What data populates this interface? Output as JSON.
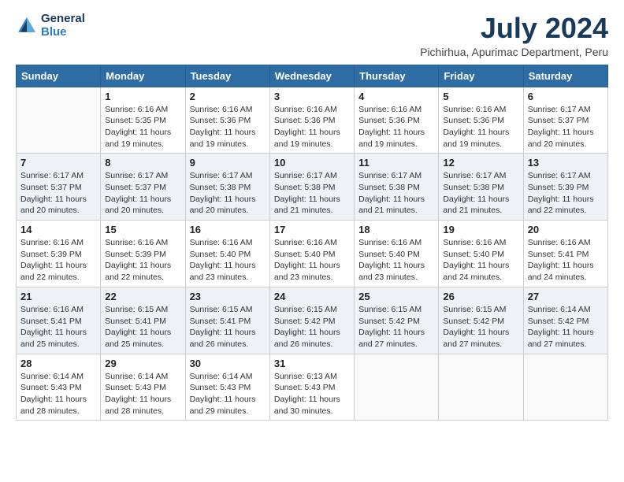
{
  "header": {
    "logo_line1": "General",
    "logo_line2": "Blue",
    "title": "July 2024",
    "subtitle": "Pichirhua, Apurimac Department, Peru"
  },
  "weekdays": [
    "Sunday",
    "Monday",
    "Tuesday",
    "Wednesday",
    "Thursday",
    "Friday",
    "Saturday"
  ],
  "weeks": [
    [
      {
        "day": "",
        "info": ""
      },
      {
        "day": "1",
        "info": "Sunrise: 6:16 AM\nSunset: 5:35 PM\nDaylight: 11 hours\nand 19 minutes."
      },
      {
        "day": "2",
        "info": "Sunrise: 6:16 AM\nSunset: 5:36 PM\nDaylight: 11 hours\nand 19 minutes."
      },
      {
        "day": "3",
        "info": "Sunrise: 6:16 AM\nSunset: 5:36 PM\nDaylight: 11 hours\nand 19 minutes."
      },
      {
        "day": "4",
        "info": "Sunrise: 6:16 AM\nSunset: 5:36 PM\nDaylight: 11 hours\nand 19 minutes."
      },
      {
        "day": "5",
        "info": "Sunrise: 6:16 AM\nSunset: 5:36 PM\nDaylight: 11 hours\nand 19 minutes."
      },
      {
        "day": "6",
        "info": "Sunrise: 6:17 AM\nSunset: 5:37 PM\nDaylight: 11 hours\nand 20 minutes."
      }
    ],
    [
      {
        "day": "7",
        "info": "Sunrise: 6:17 AM\nSunset: 5:37 PM\nDaylight: 11 hours\nand 20 minutes."
      },
      {
        "day": "8",
        "info": "Sunrise: 6:17 AM\nSunset: 5:37 PM\nDaylight: 11 hours\nand 20 minutes."
      },
      {
        "day": "9",
        "info": "Sunrise: 6:17 AM\nSunset: 5:38 PM\nDaylight: 11 hours\nand 20 minutes."
      },
      {
        "day": "10",
        "info": "Sunrise: 6:17 AM\nSunset: 5:38 PM\nDaylight: 11 hours\nand 21 minutes."
      },
      {
        "day": "11",
        "info": "Sunrise: 6:17 AM\nSunset: 5:38 PM\nDaylight: 11 hours\nand 21 minutes."
      },
      {
        "day": "12",
        "info": "Sunrise: 6:17 AM\nSunset: 5:38 PM\nDaylight: 11 hours\nand 21 minutes."
      },
      {
        "day": "13",
        "info": "Sunrise: 6:17 AM\nSunset: 5:39 PM\nDaylight: 11 hours\nand 22 minutes."
      }
    ],
    [
      {
        "day": "14",
        "info": "Sunrise: 6:16 AM\nSunset: 5:39 PM\nDaylight: 11 hours\nand 22 minutes."
      },
      {
        "day": "15",
        "info": "Sunrise: 6:16 AM\nSunset: 5:39 PM\nDaylight: 11 hours\nand 22 minutes."
      },
      {
        "day": "16",
        "info": "Sunrise: 6:16 AM\nSunset: 5:40 PM\nDaylight: 11 hours\nand 23 minutes."
      },
      {
        "day": "17",
        "info": "Sunrise: 6:16 AM\nSunset: 5:40 PM\nDaylight: 11 hours\nand 23 minutes."
      },
      {
        "day": "18",
        "info": "Sunrise: 6:16 AM\nSunset: 5:40 PM\nDaylight: 11 hours\nand 23 minutes."
      },
      {
        "day": "19",
        "info": "Sunrise: 6:16 AM\nSunset: 5:40 PM\nDaylight: 11 hours\nand 24 minutes."
      },
      {
        "day": "20",
        "info": "Sunrise: 6:16 AM\nSunset: 5:41 PM\nDaylight: 11 hours\nand 24 minutes."
      }
    ],
    [
      {
        "day": "21",
        "info": "Sunrise: 6:16 AM\nSunset: 5:41 PM\nDaylight: 11 hours\nand 25 minutes."
      },
      {
        "day": "22",
        "info": "Sunrise: 6:15 AM\nSunset: 5:41 PM\nDaylight: 11 hours\nand 25 minutes."
      },
      {
        "day": "23",
        "info": "Sunrise: 6:15 AM\nSunset: 5:41 PM\nDaylight: 11 hours\nand 26 minutes."
      },
      {
        "day": "24",
        "info": "Sunrise: 6:15 AM\nSunset: 5:42 PM\nDaylight: 11 hours\nand 26 minutes."
      },
      {
        "day": "25",
        "info": "Sunrise: 6:15 AM\nSunset: 5:42 PM\nDaylight: 11 hours\nand 27 minutes."
      },
      {
        "day": "26",
        "info": "Sunrise: 6:15 AM\nSunset: 5:42 PM\nDaylight: 11 hours\nand 27 minutes."
      },
      {
        "day": "27",
        "info": "Sunrise: 6:14 AM\nSunset: 5:42 PM\nDaylight: 11 hours\nand 27 minutes."
      }
    ],
    [
      {
        "day": "28",
        "info": "Sunrise: 6:14 AM\nSunset: 5:43 PM\nDaylight: 11 hours\nand 28 minutes."
      },
      {
        "day": "29",
        "info": "Sunrise: 6:14 AM\nSunset: 5:43 PM\nDaylight: 11 hours\nand 28 minutes."
      },
      {
        "day": "30",
        "info": "Sunrise: 6:14 AM\nSunset: 5:43 PM\nDaylight: 11 hours\nand 29 minutes."
      },
      {
        "day": "31",
        "info": "Sunrise: 6:13 AM\nSunset: 5:43 PM\nDaylight: 11 hours\nand 30 minutes."
      },
      {
        "day": "",
        "info": ""
      },
      {
        "day": "",
        "info": ""
      },
      {
        "day": "",
        "info": ""
      }
    ]
  ]
}
